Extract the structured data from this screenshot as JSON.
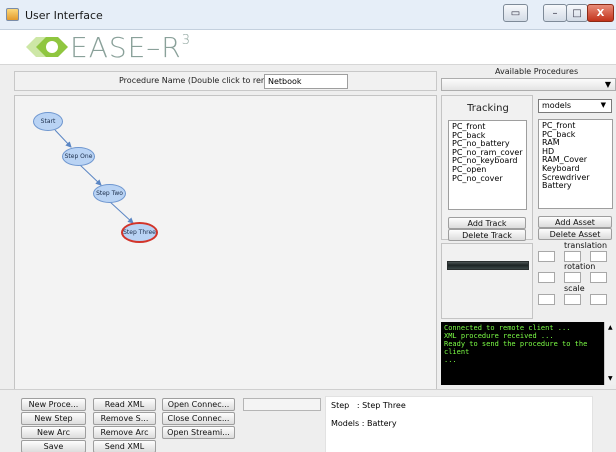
{
  "window": {
    "title": "User Interface",
    "controls": [
      "restore",
      "minimize",
      "maximize",
      "close"
    ],
    "close_glyph": "X"
  },
  "logo": {
    "text": "EASE–R",
    "superscript": "3",
    "color": "#8aa19a",
    "accent_color": "#8fc63f"
  },
  "procedure": {
    "name_label": "Procedure Name (Double click to rename)",
    "name_value": "Netbook"
  },
  "available_procedures": {
    "label": "Available Procedures",
    "selected": ""
  },
  "graph": {
    "nodes": [
      {
        "label": "Start",
        "selected": false
      },
      {
        "label": "Step One",
        "selected": false
      },
      {
        "label": "Step Two",
        "selected": false
      },
      {
        "label": "Step Three",
        "selected": true
      }
    ],
    "node_color": "#b9d3f4",
    "selected_border_color": "#d2342a"
  },
  "tracking": {
    "title": "Tracking",
    "items": [
      "PC_front",
      "PC_back",
      "PC_no_battery",
      "PC_no_ram_cover",
      "PC_no_keyboard",
      "PC_open",
      "PC_no_cover"
    ],
    "add_button": "Add Track",
    "delete_button": "Delete Track"
  },
  "assets": {
    "category": "models",
    "items": [
      "PC_front",
      "PC_back",
      "RAM",
      "HD",
      "RAM_Cover",
      "Keyboard",
      "Screwdriver",
      "Battery"
    ],
    "add_button": "Add Asset",
    "delete_button": "Delete Asset",
    "translation_label": "translation",
    "rotation_label": "rotation",
    "scale_label": "scale"
  },
  "console": {
    "lines": [
      "Connected to remote client ...",
      "XML procedure received ...",
      "Ready to send the procedure to the client",
      "..."
    ],
    "text_color": "#7cff46"
  },
  "toolbar": {
    "col1": [
      "New Proce...",
      "New Step",
      "New Arc",
      "Save"
    ],
    "col2": [
      "Read XML",
      "Remove S...",
      "Remove Arc",
      "Send XML"
    ],
    "col3": [
      "Open Connec...",
      "Close Connec...",
      "Open Streami..."
    ]
  },
  "info": {
    "step_label": "Step",
    "step_value": ": Step Three",
    "models_label": "Models",
    "models_value": ": Battery"
  }
}
